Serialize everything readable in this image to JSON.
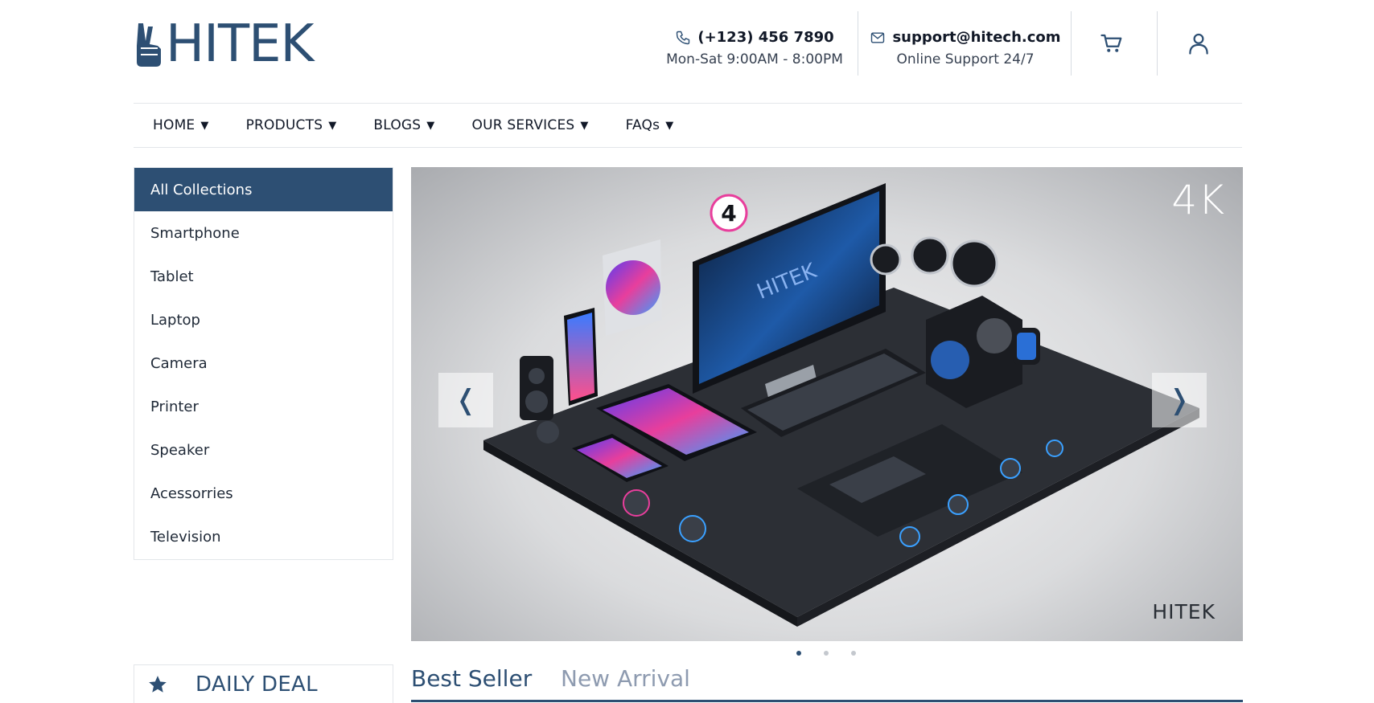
{
  "header": {
    "logo_text": "HITEK",
    "phone": {
      "number": "(+123) 456 7890",
      "hours": "Mon-Sat 9:00AM - 8:00PM"
    },
    "email": {
      "address": "support@hitech.com",
      "note": "Online Support 24/7"
    },
    "icons": {
      "phone": "phone-icon",
      "mail": "mail-icon",
      "cart": "cart-icon",
      "user": "user-icon"
    }
  },
  "nav": {
    "items": [
      {
        "label": "HOME"
      },
      {
        "label": "PRODUCTS"
      },
      {
        "label": "BLOGS"
      },
      {
        "label": "OUR SERVICES"
      },
      {
        "label": "FAQs"
      }
    ]
  },
  "sidebar": {
    "title": "All Collections",
    "items": [
      {
        "label": "Smartphone"
      },
      {
        "label": "Tablet"
      },
      {
        "label": "Laptop"
      },
      {
        "label": "Camera"
      },
      {
        "label": "Printer"
      },
      {
        "label": "Speaker"
      },
      {
        "label": "Acessorries"
      },
      {
        "label": "Television"
      }
    ]
  },
  "hero": {
    "badge": "4K",
    "brand": "HITEK",
    "screen_brand": "HITEK",
    "prev_glyph": "❬",
    "next_glyph": "❭",
    "slide_count": 3,
    "active_slide": 1
  },
  "daily_deal": {
    "title": "DAILY DEAL"
  },
  "tabs": [
    {
      "label": "Best Seller",
      "active": true
    },
    {
      "label": "New Arrival",
      "active": false
    }
  ],
  "colors": {
    "brand": "#2d4f73",
    "inactive_tab": "#8e9bb0",
    "divider": "#e3e6ea"
  }
}
